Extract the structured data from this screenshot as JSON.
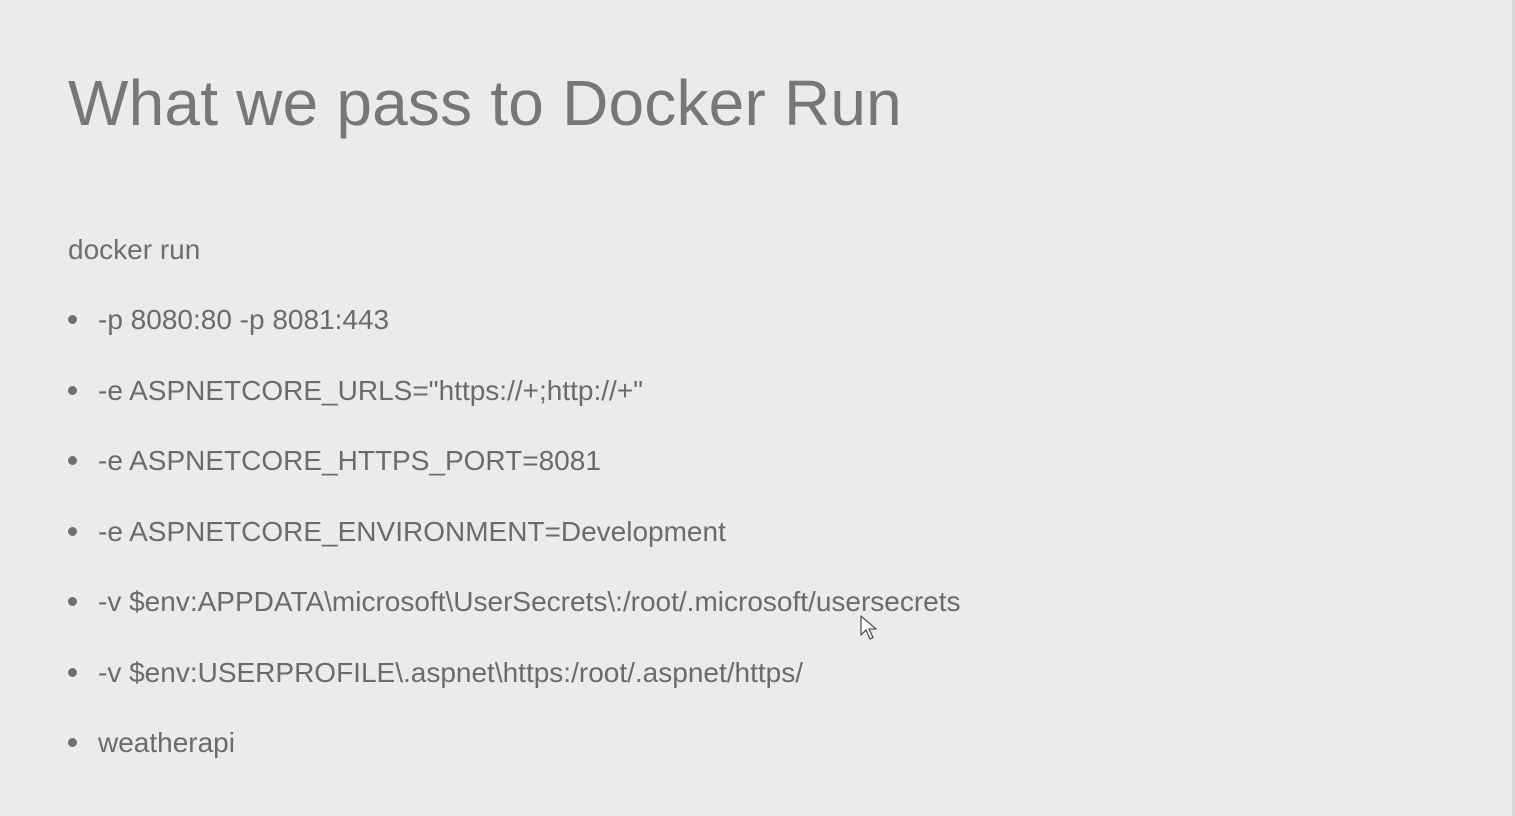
{
  "slide": {
    "title": "What we pass to Docker Run",
    "intro": "docker run",
    "bullets": [
      "-p 8080:80 -p 8081:443",
      "-e ASPNETCORE_URLS=\"https://+;http://+\"",
      "-e ASPNETCORE_HTTPS_PORT=8081",
      "-e ASPNETCORE_ENVIRONMENT=Development",
      "-v $env:APPDATA\\microsoft\\UserSecrets\\:/root/.microsoft/usersecrets",
      "-v $env:USERPROFILE\\.aspnet\\https:/root/.aspnet/https/",
      "weatherapi"
    ]
  },
  "icons": {
    "cursor": "mouse-pointer-icon"
  },
  "colors": {
    "background": "#ebebeb",
    "title_text": "#777777",
    "body_text": "#6b6b6b"
  }
}
